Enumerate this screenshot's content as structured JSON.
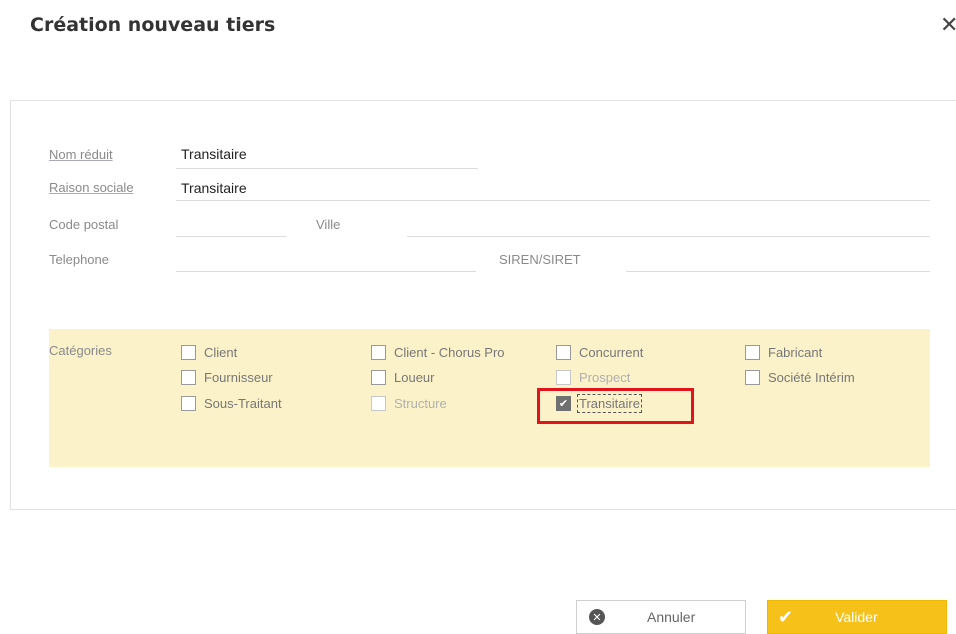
{
  "dialog": {
    "title": "Création nouveau tiers",
    "close_symbol": "✕"
  },
  "form": {
    "nom_reduit": {
      "label": "Nom réduit",
      "value": "Transitaire"
    },
    "raison_sociale": {
      "label": "Raison sociale",
      "value": "Transitaire"
    },
    "code_postal": {
      "label": "Code postal",
      "value": ""
    },
    "ville": {
      "label": "Ville",
      "value": ""
    },
    "telephone": {
      "label": "Telephone",
      "value": ""
    },
    "siren": {
      "label": "SIREN/SIRET",
      "value": ""
    }
  },
  "categories": {
    "label": "Catégories",
    "items": [
      {
        "label": "Client",
        "checked": false,
        "disabled": false
      },
      {
        "label": "Fournisseur",
        "checked": false,
        "disabled": false
      },
      {
        "label": "Sous-Traitant",
        "checked": false,
        "disabled": false
      },
      {
        "label": "Client - Chorus Pro",
        "checked": false,
        "disabled": false
      },
      {
        "label": "Loueur",
        "checked": false,
        "disabled": false
      },
      {
        "label": "Structure",
        "checked": false,
        "disabled": true
      },
      {
        "label": "Concurrent",
        "checked": false,
        "disabled": false
      },
      {
        "label": "Prospect",
        "checked": false,
        "disabled": true
      },
      {
        "label": "Transitaire",
        "checked": true,
        "disabled": false
      },
      {
        "label": "Fabricant",
        "checked": false,
        "disabled": false
      },
      {
        "label": "Société Intérim",
        "checked": false,
        "disabled": false
      }
    ]
  },
  "buttons": {
    "cancel": "Annuler",
    "validate": "Valider"
  },
  "colors": {
    "accent": "#f6c21a",
    "category_bg": "#fbf2c9",
    "highlight": "#e0141c"
  },
  "icons": {
    "cancel": "x-circle-icon",
    "validate": "check-icon",
    "close": "close-icon"
  }
}
